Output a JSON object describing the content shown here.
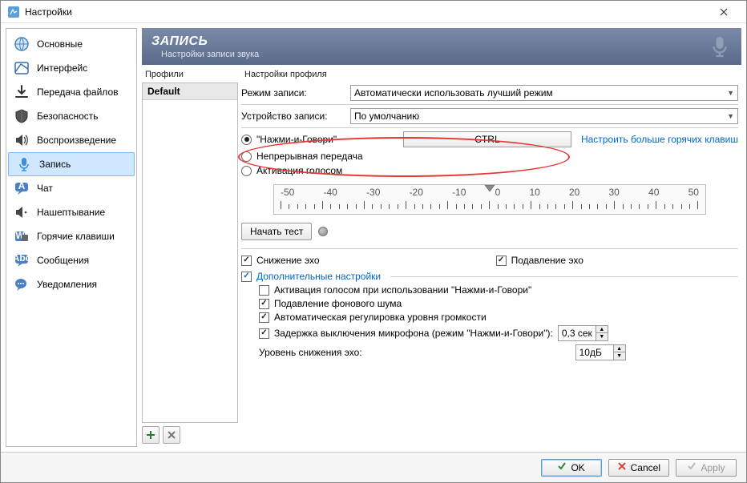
{
  "window": {
    "title": "Настройки"
  },
  "sidebar": {
    "items": [
      {
        "label": "Основные"
      },
      {
        "label": "Интерфейс"
      },
      {
        "label": "Передача файлов"
      },
      {
        "label": "Безопасность"
      },
      {
        "label": "Воспроизведение"
      },
      {
        "label": "Запись"
      },
      {
        "label": "Чат"
      },
      {
        "label": "Нашептывание"
      },
      {
        "label": "Горячие клавиши"
      },
      {
        "label": "Сообщения"
      },
      {
        "label": "Уведомления"
      }
    ]
  },
  "banner": {
    "title": "ЗАПИСЬ",
    "sub": "Настройки записи звука"
  },
  "profiles": {
    "header": "Профили",
    "items": [
      {
        "name": "Default"
      }
    ]
  },
  "settings": {
    "header": "Настройки профиля",
    "mode_label": "Режим записи:",
    "mode_value": "Автоматически использовать лучший режим",
    "device_label": "Устройство записи:",
    "device_value": "По умолчанию",
    "ptt_label": "\"Нажми-и-Говори\"",
    "ptt_key": "CTRL",
    "more_hotkeys": "Настроить больше горячих клавиш",
    "continuous_label": "Непрерывная передача",
    "vad_label": "Активация голосом",
    "start_test": "Начать тест",
    "echo_reduce": "Снижение эхо",
    "echo_cancel": "Подавление эхо",
    "advanced": "Дополнительные настройки",
    "adv_vad_ptt": "Активация голосом при использовании \"Нажми-и-Говори\"",
    "adv_noise": "Подавление фонового шума",
    "adv_agc": "Автоматическая регулировка уровня громкости",
    "adv_delay_label": "Задержка выключения микрофона (режим \"Нажми-и-Говори\"):",
    "adv_delay_value": "0,3 сек",
    "adv_echo_level_label": "Уровень снижения эхо:",
    "adv_echo_level_value": "10дБ",
    "ruler_labels": [
      "-50",
      "-40",
      "-30",
      "-20",
      "-10",
      "0",
      "10",
      "20",
      "30",
      "40",
      "50"
    ]
  },
  "footer": {
    "ok": "OK",
    "cancel": "Cancel",
    "apply": "Apply"
  }
}
